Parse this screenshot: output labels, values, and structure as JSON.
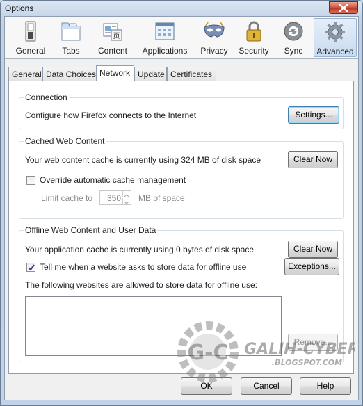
{
  "window": {
    "title": "Options"
  },
  "panes": [
    {
      "label": "General",
      "icon": "general-icon"
    },
    {
      "label": "Tabs",
      "icon": "tabs-icon"
    },
    {
      "label": "Content",
      "icon": "content-icon"
    },
    {
      "label": "Applications",
      "icon": "applications-icon"
    },
    {
      "label": "Privacy",
      "icon": "privacy-mask-icon"
    },
    {
      "label": "Security",
      "icon": "security-lock-icon"
    },
    {
      "label": "Sync",
      "icon": "sync-icon"
    },
    {
      "label": "Advanced",
      "icon": "advanced-gear-icon",
      "selected": true
    }
  ],
  "tabs": [
    {
      "label": "General"
    },
    {
      "label": "Data Choices"
    },
    {
      "label": "Network",
      "selected": true
    },
    {
      "label": "Update"
    },
    {
      "label": "Certificates"
    }
  ],
  "connection": {
    "caption": "Connection",
    "description": "Configure how Firefox connects to the Internet",
    "settings_button": "Settings..."
  },
  "cache": {
    "caption": "Cached Web Content",
    "usage_text": "Your web content cache is currently using 324 MB of disk space",
    "clear_button": "Clear Now",
    "override_label": "Override automatic cache management",
    "override_checked": false,
    "limit_label": "Limit cache to",
    "limit_value": "350",
    "limit_unit": "MB of space"
  },
  "offline": {
    "caption": "Offline Web Content and User Data",
    "usage_text": "Your application cache is currently using 0 bytes of disk space",
    "clear_button": "Clear Now",
    "tell_me_label": "Tell me when a website asks to store data for offline use",
    "tell_me_checked": true,
    "exceptions_button": "Exceptions...",
    "allowed_label": "The following websites are allowed to store data for offline use:",
    "allowed_sites": [],
    "remove_button": "Remove..."
  },
  "footer": {
    "ok": "OK",
    "cancel": "Cancel",
    "help": "Help"
  },
  "watermark": {
    "logo_text": "G-C",
    "brand": "GALIH-CYBER",
    "domain": ".BLOGSPOT.COM"
  },
  "colors": {
    "accent": "#3c7fb1",
    "window_frame": "#c2d3e7",
    "selected_pane": "#c9dbf0"
  }
}
